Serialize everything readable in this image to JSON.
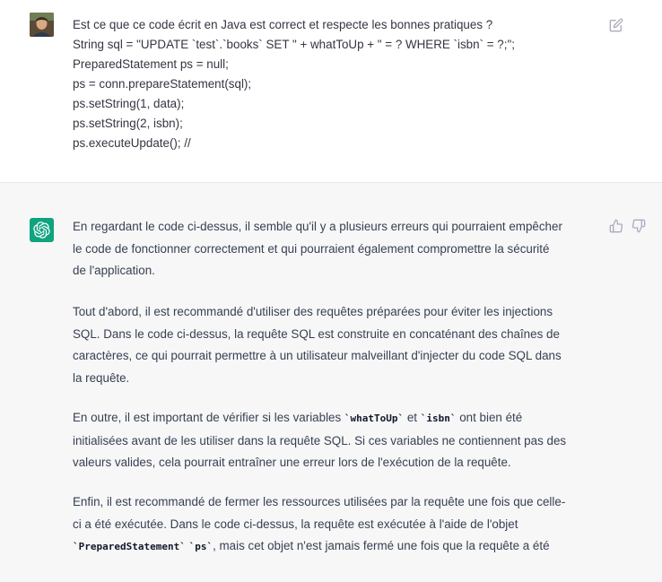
{
  "user_message": {
    "lines": [
      "Est ce que ce code écrit en Java est correct et respecte les bonnes pratiques ?",
      "String sql = \"UPDATE `test`.`books` SET \" + whatToUp + \" = ? WHERE `isbn` = ?;\";",
      "PreparedStatement ps = null;",
      "ps = conn.prepareStatement(sql);",
      "ps.setString(1, data);",
      "ps.setString(2, isbn);",
      "ps.executeUpdate(); //"
    ],
    "edit_icon": "edit-icon"
  },
  "assistant_message": {
    "icons": {
      "avatar": "openai-logo-icon",
      "like": "thumbs-up-icon",
      "dislike": "thumbs-down-icon"
    },
    "p1": {
      "l1": "En regardant le code ci-dessus, il semble qu'il y a plusieurs erreurs qui pourraient empêcher",
      "l2": "le code de fonctionner correctement et qui pourraient également compromettre la sécurité",
      "l3": "de l'application."
    },
    "p2": {
      "l1": "Tout d'abord, il est recommandé d'utiliser des requêtes préparées pour éviter les injections",
      "l2": "SQL. Dans le code ci-dessus, la requête SQL est construite en concaténant des chaînes de",
      "l3": "caractères, ce qui pourrait permettre à un utilisateur malveillant d'injecter du code SQL dans",
      "l4": "la requête."
    },
    "p3": {
      "l1_a": "En outre, il est important de vérifier si les variables ",
      "code1": "`whatToUp`",
      "l1_b": " et ",
      "code2": "`isbn`",
      "l1_c": " ont bien été",
      "l2": "initialisées avant de les utiliser dans la requête SQL. Si ces variables ne contiennent pas des",
      "l3": "valeurs valides, cela pourrait entraîner une erreur lors de l'exécution de la requête."
    },
    "p4": {
      "l1": "Enfin, il est recommandé de fermer les ressources utilisées par la requête une fois que celle-",
      "l2": "ci a été exécutée. Dans le code ci-dessus, la requête est exécutée à l'aide de l'objet",
      "code1": "`PreparedStatement`",
      "code2": "`ps`",
      "l3_tail": ", mais cet objet n'est jamais fermé une fois que la requête a été"
    }
  }
}
